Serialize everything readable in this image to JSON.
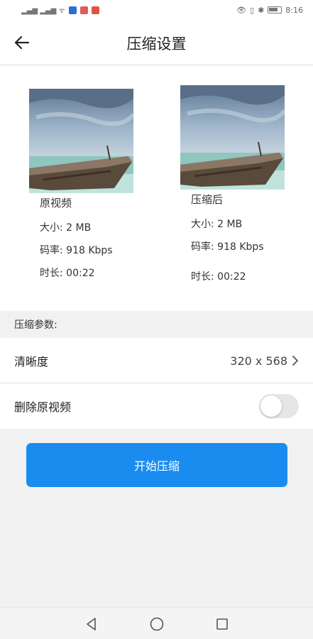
{
  "status_bar": {
    "signal_text": "ᵀᴺˡˡ ᵀᴺˡˡ",
    "time": "8:16",
    "app_colors": [
      "#2a6fd6",
      "#e05a5a",
      "#e0543f"
    ]
  },
  "header": {
    "title": "压缩设置",
    "back_icon": "arrow-left-icon"
  },
  "preview": {
    "original": {
      "name": "原视频",
      "size": "大小: 2 MB",
      "bitrate": "码率: 918 Kbps",
      "duration": "时长: 00:22"
    },
    "compressed": {
      "name": "压缩后",
      "size": "大小: 2 MB",
      "bitrate": "码率: 918 Kbps",
      "duration": "时长: 00:22"
    }
  },
  "params": {
    "section_title": "压缩参数:",
    "resolution_label": "清晰度",
    "resolution_value": "320 x 568",
    "delete_label": "删除原视频",
    "delete_enabled": false
  },
  "actions": {
    "start_label": "开始压缩"
  },
  "colors": {
    "accent": "#1a8cf0",
    "toggle_off": "#e6e6e6"
  }
}
